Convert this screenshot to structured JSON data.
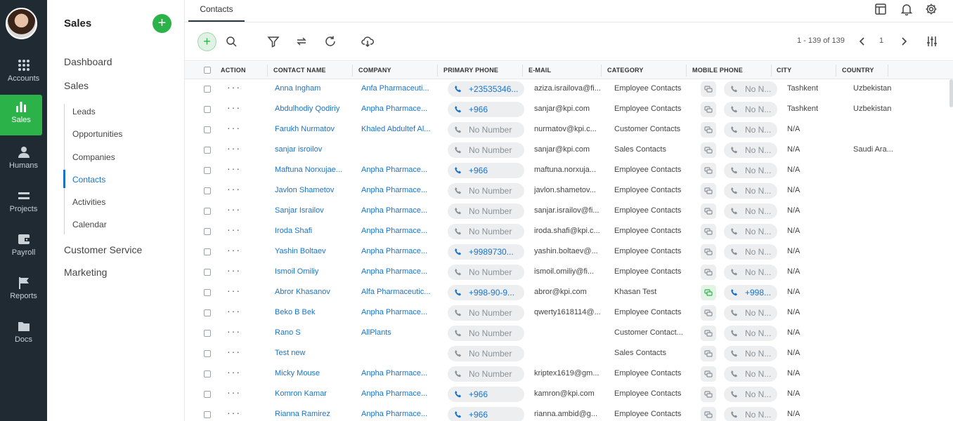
{
  "rail": {
    "items": [
      {
        "label": "Accounts",
        "icon": "grid-icon"
      },
      {
        "label": "Sales",
        "icon": "bar-chart-icon",
        "active": true
      },
      {
        "label": "Humans",
        "icon": "person-icon"
      },
      {
        "label": "Projects",
        "icon": "projects-icon"
      },
      {
        "label": "Payroll",
        "icon": "wallet-icon"
      },
      {
        "label": "Reports",
        "icon": "flag-icon"
      },
      {
        "label": "Docs",
        "icon": "folder-icon"
      }
    ]
  },
  "sidebar": {
    "title": "Sales",
    "top": [
      "Dashboard",
      "Sales"
    ],
    "sub": [
      "Leads",
      "Opportunities",
      "Companies",
      "Contacts",
      "Activities",
      "Calendar"
    ],
    "active_sub": "Contacts",
    "bottom": [
      "Customer Service",
      "Marketing"
    ]
  },
  "topbar": {
    "tab": "Contacts"
  },
  "pager": {
    "range": "1 - 139 of 139",
    "page": "1"
  },
  "columns": [
    "ACTION",
    "CONTACT NAME",
    "COMPANY",
    "PRIMARY PHONE",
    "E-MAIL",
    "CATEGORY",
    "MOBILE PHONE",
    "CITY",
    "COUNTRY"
  ],
  "colors": {
    "accent": "#2bb34a",
    "link": "#1a73c9",
    "rail": "#1f2a33"
  },
  "rows": [
    {
      "name": "Anna Ingham",
      "company": "Anfa Pharmaceuti...",
      "phone": "+23535346...",
      "phone_active": true,
      "email": "aziza.israilova@fi...",
      "category": "Employee Contacts",
      "mobile": "No N...",
      "mobile_active": false,
      "city": "Tashkent",
      "country": "Uzbekistan"
    },
    {
      "name": "Abdulhodiy Qodiriy",
      "company": "Anpha Pharmace...",
      "phone": "+966",
      "phone_active": true,
      "email": "sanjar@kpi.com",
      "category": "Employee Contacts",
      "mobile": "No N...",
      "mobile_active": false,
      "city": "Tashkent",
      "country": "Uzbekistan"
    },
    {
      "name": "Farukh Nurmatov",
      "company": "Khaled Abdultef Al...",
      "phone": "No Number",
      "phone_active": false,
      "email": "nurmatov@kpi.c...",
      "category": "Customer Contacts",
      "mobile": "No N...",
      "mobile_active": false,
      "city": "N/A",
      "country": ""
    },
    {
      "name": "sanjar isroilov",
      "company": "",
      "phone": "No Number",
      "phone_active": false,
      "email": "sanjar@kpi.com",
      "category": "Sales Contacts",
      "mobile": "No N...",
      "mobile_active": false,
      "city": "N/A",
      "country": "Saudi Ara..."
    },
    {
      "name": "Maftuna Norxujae...",
      "company": "Anpha Pharmace...",
      "phone": "+966",
      "phone_active": true,
      "email": "maftuna.norxuja...",
      "category": "Employee Contacts",
      "mobile": "No N...",
      "mobile_active": false,
      "city": "N/A",
      "country": ""
    },
    {
      "name": "Javlon Shametov",
      "company": "Anpha Pharmace...",
      "phone": "No Number",
      "phone_active": false,
      "email": "javlon.shametov...",
      "category": "Employee Contacts",
      "mobile": "No N...",
      "mobile_active": false,
      "city": "N/A",
      "country": ""
    },
    {
      "name": "Sanjar Israilov",
      "company": "Anpha Pharmace...",
      "phone": "No Number",
      "phone_active": false,
      "email": "sanjar.israilov@fi...",
      "category": "Employee Contacts",
      "mobile": "No N...",
      "mobile_active": false,
      "city": "N/A",
      "country": ""
    },
    {
      "name": "Iroda Shafi",
      "company": "Anpha Pharmace...",
      "phone": "No Number",
      "phone_active": false,
      "email": "iroda.shafi@kpi.c...",
      "category": "Employee Contacts",
      "mobile": "No N...",
      "mobile_active": false,
      "city": "N/A",
      "country": ""
    },
    {
      "name": "Yashin Boltaev",
      "company": "Anpha Pharmace...",
      "phone": "+9989730...",
      "phone_active": true,
      "email": "yashin.boltaev@...",
      "category": "Employee Contacts",
      "mobile": "No N...",
      "mobile_active": false,
      "city": "N/A",
      "country": ""
    },
    {
      "name": "Ismoil Omiliy",
      "company": "Anpha Pharmace...",
      "phone": "No Number",
      "phone_active": false,
      "email": "ismoil.omiliy@fi...",
      "category": "Employee Contacts",
      "mobile": "No N...",
      "mobile_active": false,
      "city": "N/A",
      "country": ""
    },
    {
      "name": "Abror Khasanov",
      "company": "Alfa Pharmaceutic...",
      "phone": "+998-90-9...",
      "phone_active": true,
      "email": "abror@kpi.com",
      "category": "Khasan Test",
      "mobile": "+998...",
      "mobile_active": true,
      "city": "N/A",
      "country": ""
    },
    {
      "name": "Beko B Bek",
      "company": "Anpha Pharmace...",
      "phone": "No Number",
      "phone_active": false,
      "email": "qwerty1618114@...",
      "category": "Employee Contacts",
      "mobile": "No N...",
      "mobile_active": false,
      "city": "N/A",
      "country": ""
    },
    {
      "name": "Rano S",
      "company": "AllPlants",
      "phone": "No Number",
      "phone_active": false,
      "email": "",
      "category": "Customer Contact...",
      "mobile": "No N...",
      "mobile_active": false,
      "city": "N/A",
      "country": ""
    },
    {
      "name": "Test new",
      "company": "",
      "phone": "No Number",
      "phone_active": false,
      "email": "",
      "category": "Sales Contacts",
      "mobile": "No N...",
      "mobile_active": false,
      "city": "N/A",
      "country": ""
    },
    {
      "name": "Micky Mouse",
      "company": "Anpha Pharmace...",
      "phone": "No Number",
      "phone_active": false,
      "email": "kriptex1619@gm...",
      "category": "Employee Contacts",
      "mobile": "No N...",
      "mobile_active": false,
      "city": "N/A",
      "country": ""
    },
    {
      "name": "Komron Kamar",
      "company": "Anpha Pharmace...",
      "phone": "+966",
      "phone_active": true,
      "email": "kamron@kpi.com",
      "category": "Employee Contacts",
      "mobile": "No N...",
      "mobile_active": false,
      "city": "N/A",
      "country": ""
    },
    {
      "name": "Rianna Ramirez",
      "company": "Anpha Pharmace...",
      "phone": "+966",
      "phone_active": true,
      "email": "rianna.ambid@g...",
      "category": "Employee Contacts",
      "mobile": "No N...",
      "mobile_active": false,
      "city": "N/A",
      "country": ""
    }
  ]
}
